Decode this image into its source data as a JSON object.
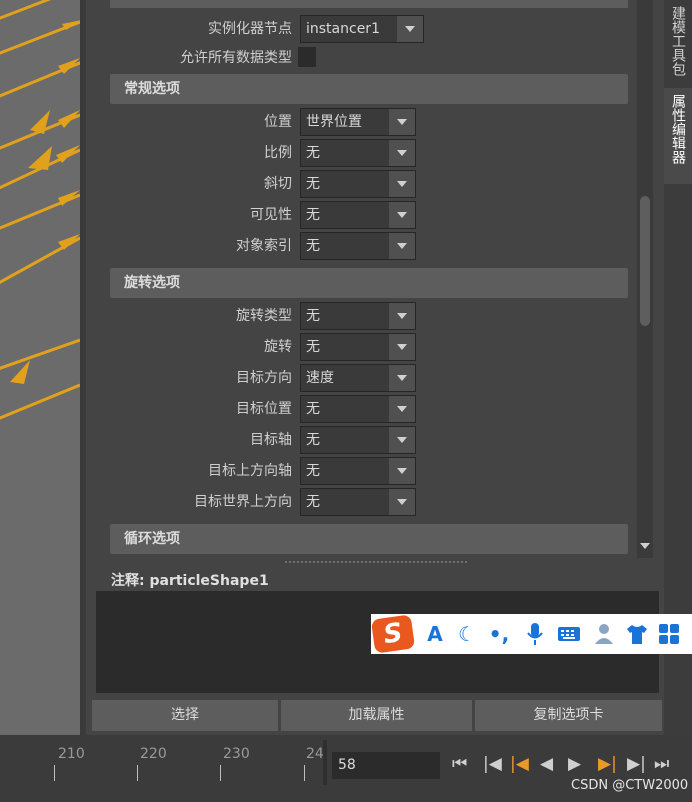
{
  "attribute_editor": {
    "instancer_node_label": "实例化器节点",
    "instancer_node_value": "instancer1",
    "allow_all_types_label": "允许所有数据类型",
    "sections": {
      "general": {
        "title": "常规选项",
        "rows": [
          {
            "label": "位置",
            "value": "世界位置"
          },
          {
            "label": "比例",
            "value": "无"
          },
          {
            "label": "斜切",
            "value": "无"
          },
          {
            "label": "可见性",
            "value": "无"
          },
          {
            "label": "对象索引",
            "value": "无"
          }
        ]
      },
      "rotation": {
        "title": "旋转选项",
        "rows": [
          {
            "label": "旋转类型",
            "value": "无"
          },
          {
            "label": "旋转",
            "value": "无"
          },
          {
            "label": "目标方向",
            "value": "速度"
          },
          {
            "label": "目标位置",
            "value": "无"
          },
          {
            "label": "目标轴",
            "value": "无"
          },
          {
            "label": "目标上方向轴",
            "value": "无"
          },
          {
            "label": "目标世界上方向",
            "value": "无"
          }
        ]
      },
      "cycle": {
        "title": "循环选项"
      }
    },
    "notes_label": "注释:  particleShape1",
    "buttons": {
      "select": "选择",
      "load_attributes": "加载属性",
      "copy_tab": "复制选项卡"
    }
  },
  "side_tabs": {
    "toolkit": "建模工具包",
    "attribute_editor": "属性编辑器"
  },
  "timeline": {
    "ticks": [
      "210",
      "220",
      "230",
      "24"
    ],
    "current_frame": "58"
  },
  "ime_toolbar": {
    "logo": "S",
    "icons": [
      "A",
      "moon",
      "comma",
      "mic",
      "keyboard",
      "user",
      "shirt",
      "grid"
    ]
  },
  "watermark": "CSDN @CTW2000",
  "colors": {
    "arrow": "#e1a11c",
    "panel": "#444444",
    "section": "#5d5d5d",
    "field": "#2b2b2b"
  }
}
